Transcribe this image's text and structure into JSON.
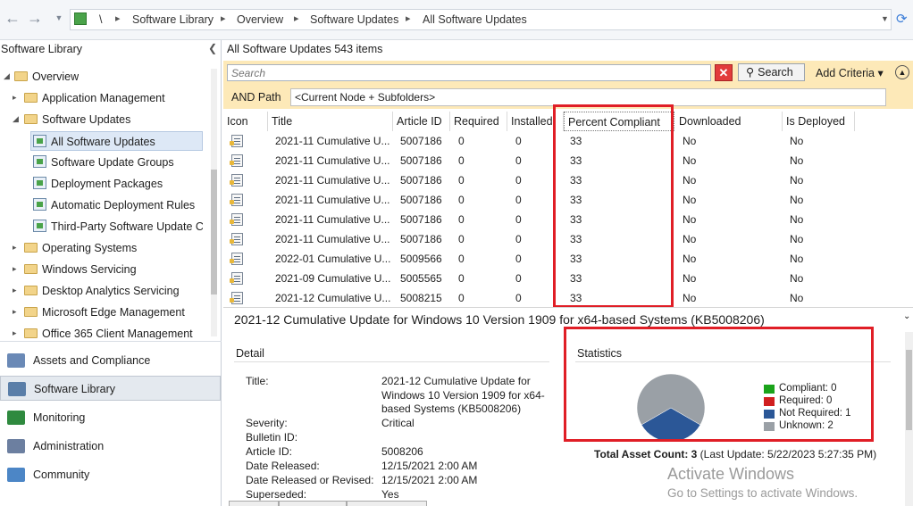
{
  "nav": {
    "back_icon": "back-arrow-icon",
    "forward_icon": "forward-arrow-icon",
    "root_sep": "\\",
    "breadcrumbs": [
      "Software Library",
      "Overview",
      "Software Updates",
      "All Software Updates"
    ]
  },
  "left": {
    "title": "Software Library",
    "tree": [
      {
        "label": "Overview",
        "level": 0,
        "expanded": true
      },
      {
        "label": "Application Management",
        "level": 1
      },
      {
        "label": "Software Updates",
        "level": 1,
        "expanded": true
      },
      {
        "label": "All Software Updates",
        "level": 2,
        "selected": true
      },
      {
        "label": "Software Update Groups",
        "level": 2
      },
      {
        "label": "Deployment Packages",
        "level": 2
      },
      {
        "label": "Automatic Deployment Rules",
        "level": 2
      },
      {
        "label": "Third-Party Software Update Cat",
        "level": 2
      },
      {
        "label": "Operating Systems",
        "level": 1
      },
      {
        "label": "Windows Servicing",
        "level": 1
      },
      {
        "label": "Desktop Analytics Servicing",
        "level": 1
      },
      {
        "label": "Microsoft Edge Management",
        "level": 1
      },
      {
        "label": "Office 365 Client Management",
        "level": 1
      }
    ],
    "workspaces": [
      {
        "label": "Assets and Compliance",
        "icon": "assets-icon",
        "color": "#6a89b6"
      },
      {
        "label": "Software Library",
        "icon": "software-library-icon",
        "color": "#5a7ea8",
        "active": true
      },
      {
        "label": "Monitoring",
        "icon": "monitoring-icon",
        "color": "#2f8a3f"
      },
      {
        "label": "Administration",
        "icon": "administration-icon",
        "color": "#6c7fa0"
      },
      {
        "label": "Community",
        "icon": "community-icon",
        "color": "#4c86c6"
      }
    ]
  },
  "main": {
    "header": "All Software Updates 543 items",
    "search_placeholder": "Search",
    "search_button": "Search",
    "add_criteria": "Add Criteria ▾",
    "and_path_label": "AND Path",
    "path_value": "<Current Node + Subfolders>",
    "columns": [
      "Icon",
      "Title",
      "Article ID",
      "Required",
      "Installed",
      "Percent Compliant",
      "Downloaded",
      "Is Deployed"
    ],
    "rows": [
      {
        "title": "2021-11 Cumulative U...",
        "article": "5007186",
        "required": "0",
        "installed": "0",
        "percent": "33",
        "downloaded": "No",
        "deployed": "No"
      },
      {
        "title": "2021-11 Cumulative U...",
        "article": "5007186",
        "required": "0",
        "installed": "0",
        "percent": "33",
        "downloaded": "No",
        "deployed": "No"
      },
      {
        "title": "2021-11 Cumulative U...",
        "article": "5007186",
        "required": "0",
        "installed": "0",
        "percent": "33",
        "downloaded": "No",
        "deployed": "No"
      },
      {
        "title": "2021-11 Cumulative U...",
        "article": "5007186",
        "required": "0",
        "installed": "0",
        "percent": "33",
        "downloaded": "No",
        "deployed": "No"
      },
      {
        "title": "2021-11 Cumulative U...",
        "article": "5007186",
        "required": "0",
        "installed": "0",
        "percent": "33",
        "downloaded": "No",
        "deployed": "No"
      },
      {
        "title": "2021-11 Cumulative U...",
        "article": "5007186",
        "required": "0",
        "installed": "0",
        "percent": "33",
        "downloaded": "No",
        "deployed": "No"
      },
      {
        "title": "2022-01 Cumulative U...",
        "article": "5009566",
        "required": "0",
        "installed": "0",
        "percent": "33",
        "downloaded": "No",
        "deployed": "No"
      },
      {
        "title": "2021-09 Cumulative U...",
        "article": "5005565",
        "required": "0",
        "installed": "0",
        "percent": "33",
        "downloaded": "No",
        "deployed": "No"
      },
      {
        "title": "2021-12 Cumulative U...",
        "article": "5008215",
        "required": "0",
        "installed": "0",
        "percent": "33",
        "downloaded": "No",
        "deployed": "No"
      }
    ]
  },
  "details": {
    "title": "2021-12 Cumulative Update for Windows 10 Version 1909 for x64-based Systems (KB5008206)",
    "detail_heading": "Detail",
    "statistics_heading": "Statistics",
    "fields": {
      "title_label": "Title:",
      "title_value": "2021-12 Cumulative Update for Windows 10 Version 1909 for x64-based Systems (KB5008206)",
      "severity_label": "Severity:",
      "severity_value": "Critical",
      "bulletin_label": "Bulletin ID:",
      "bulletin_value": "",
      "article_label": "Article ID:",
      "article_value": "5008206",
      "released_label": "Date Released:",
      "released_value": "12/15/2021 2:00 AM",
      "revised_label": "Date Released or Revised:",
      "revised_value": "12/15/2021 2:00 AM",
      "superseded_label": "Superseded:",
      "superseded_value": "Yes"
    },
    "legend": [
      {
        "label": "Compliant: 0",
        "color": "#1aa31a",
        "value": 0
      },
      {
        "label": "Required: 0",
        "color": "#d01f1f",
        "value": 0
      },
      {
        "label": "Not Required: 1",
        "color": "#2b5797",
        "value": 1
      },
      {
        "label": "Unknown: 2",
        "color": "#9aa0a6",
        "value": 2
      }
    ],
    "total_label": "Total Asset Count: 3",
    "last_update": " (Last Update: 5/22/2023 5:27:35 PM)"
  },
  "watermark": {
    "line1": "Activate Windows",
    "line2": "Go to Settings to activate Windows."
  }
}
